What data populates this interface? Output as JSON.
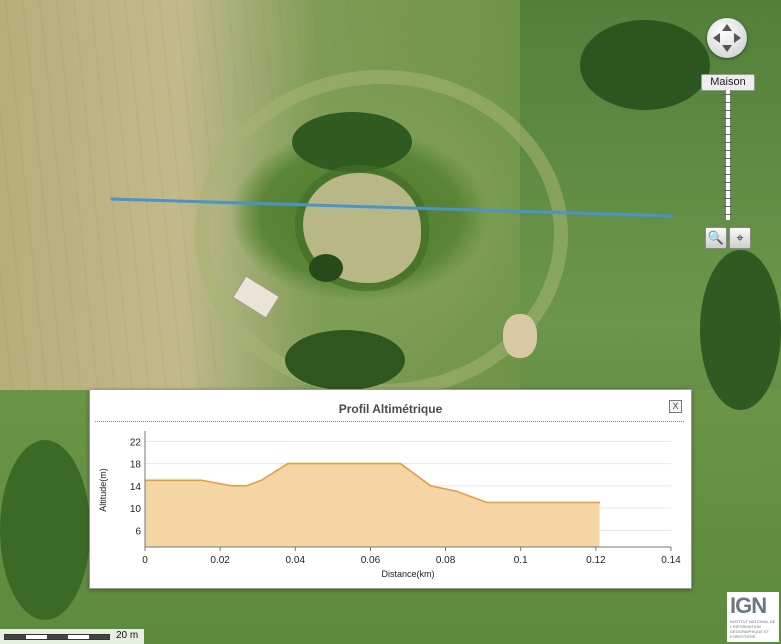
{
  "map": {
    "location_label": "Maison",
    "scale_label": "20 m",
    "logo_text": "IGN",
    "logo_subtext": "INSTITUT NATIONAL DE L'INFORMATION GÉOGRAPHIQUE ET FORESTIÈRE",
    "trace_color": "#4a94c9"
  },
  "controls": {
    "pan_icon": "pan-arrows-icon",
    "zoom_icon": "magnifier-icon",
    "locate_icon": "crosshair-icon"
  },
  "profile_panel": {
    "title": "Profil Altimétrique",
    "close_label": "X"
  },
  "chart_data": {
    "type": "area",
    "title": "Profil Altimétrique",
    "xlabel": "Distance(km)",
    "ylabel": "Altitude(m)",
    "x_ticks": [
      "0",
      "0.02",
      "0.04",
      "0.06",
      "0.08",
      "0.1",
      "0.12",
      "0.14"
    ],
    "y_ticks": [
      "6",
      "10",
      "14",
      "18",
      "22"
    ],
    "xlim": [
      0,
      0.14
    ],
    "ylim": [
      3,
      23.5
    ],
    "grid": true,
    "fill_color": "#f6d5a5",
    "line_color": "#e0a044",
    "x": [
      0,
      0.015,
      0.023,
      0.027,
      0.031,
      0.038,
      0.068,
      0.076,
      0.083,
      0.091,
      0.121
    ],
    "y": [
      15,
      15,
      14,
      14,
      15,
      18,
      18,
      14,
      13,
      11,
      11
    ]
  }
}
